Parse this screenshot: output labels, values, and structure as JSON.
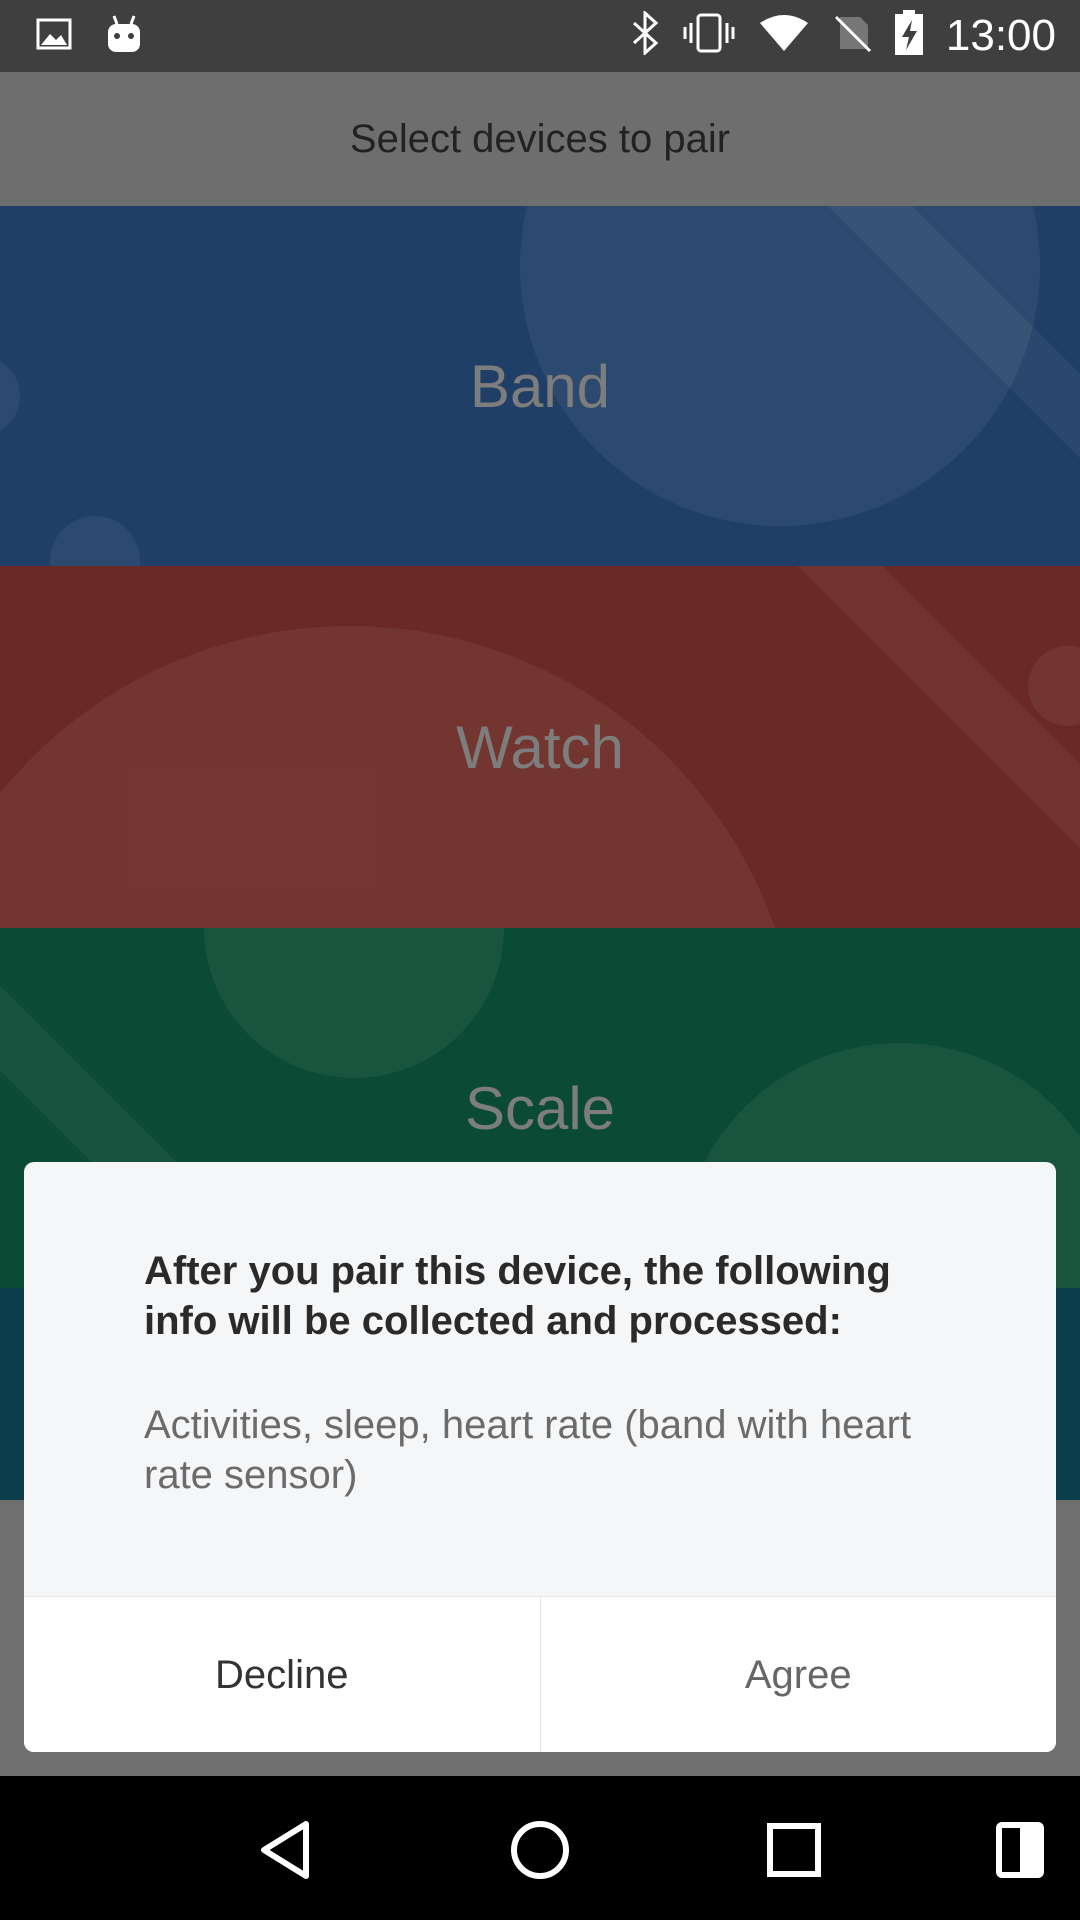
{
  "status_bar": {
    "time": "13:00",
    "icons": [
      "image-icon",
      "android-icon",
      "bluetooth-icon",
      "vibrate-icon",
      "wifi-icon",
      "no-sim-icon",
      "battery-charging-icon"
    ]
  },
  "header": {
    "title": "Select devices to pair"
  },
  "devices": [
    {
      "label": "Band",
      "color": "#1f3f66"
    },
    {
      "label": "Watch",
      "color": "#6a2924"
    },
    {
      "label": "Scale",
      "color": "#0b4a34"
    }
  ],
  "dialog": {
    "title": "After you pair this device, the following info will be collected and processed:",
    "body": "Activities, sleep, heart rate (band with heart rate sensor)",
    "decline_label": "Decline",
    "agree_label": "Agree"
  },
  "nav_bar": {
    "icons": [
      "back-icon",
      "home-icon",
      "recents-icon",
      "split-screen-icon"
    ]
  }
}
